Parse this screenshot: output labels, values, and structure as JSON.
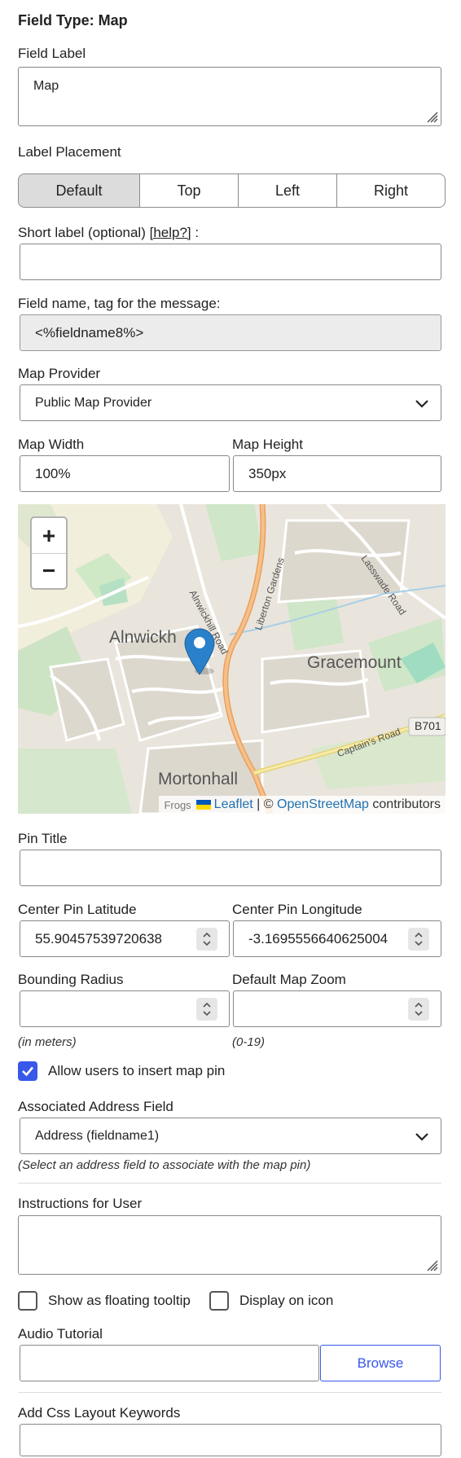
{
  "header": {
    "title": "Field Type: Map"
  },
  "field_label": {
    "label": "Field Label",
    "value": "Map"
  },
  "label_placement": {
    "label": "Label Placement",
    "options": [
      "Default",
      "Top",
      "Left",
      "Right"
    ],
    "selected": "Default"
  },
  "short_label": {
    "label_prefix": "Short label (optional) ",
    "help_link": "[help?]",
    "label_suffix": " :",
    "value": ""
  },
  "field_name": {
    "label": "Field name, tag for the message:",
    "value": "<%fieldname8%>"
  },
  "map_provider": {
    "label": "Map Provider",
    "value": "Public Map Provider"
  },
  "map_width": {
    "label": "Map Width",
    "value": "100%"
  },
  "map_height": {
    "label": "Map Height",
    "value": "350px"
  },
  "map": {
    "zoom_in": "+",
    "zoom_out": "−",
    "place_labels": [
      "Alnwickh",
      "Gracemount",
      "Mortonhall",
      "B701"
    ],
    "road_labels": [
      "Alnwickhill Road",
      "Liberton Gardens",
      "Lasswade Road",
      "Captain's Road"
    ],
    "attribution": {
      "frogs": "Frogs",
      "leaflet": "Leaflet",
      "sep": " | © ",
      "osm": "OpenStreetMap",
      "contributors": " contributors"
    },
    "pin_color": "#2a81cb"
  },
  "pin_title": {
    "label": "Pin Title",
    "value": ""
  },
  "center_lat": {
    "label": "Center Pin Latitude",
    "value": "55.90457539720638"
  },
  "center_lng": {
    "label": "Center Pin Longitude",
    "value": "-3.1695556640625004"
  },
  "bounding_radius": {
    "label": "Bounding Radius",
    "value": "",
    "hint": "(in meters)"
  },
  "default_zoom": {
    "label": "Default Map Zoom",
    "value": "",
    "hint": "(0-19)"
  },
  "allow_insert_pin": {
    "label": "Allow users to insert map pin",
    "checked": true
  },
  "associated_address": {
    "label": "Associated Address Field",
    "value": "Address (fieldname1)",
    "hint": "(Select an address field to associate with the map pin)"
  },
  "instructions": {
    "label": "Instructions for User",
    "value": ""
  },
  "floating_tooltip": {
    "label": "Show as floating tooltip",
    "checked": false
  },
  "display_on_icon": {
    "label": "Display on icon",
    "checked": false
  },
  "audio_tutorial": {
    "label": "Audio Tutorial",
    "value": "",
    "browse": "Browse"
  },
  "css_keywords": {
    "label": "Add Css Layout Keywords",
    "value": ""
  },
  "colors": {
    "accent": "#3858e9",
    "link": "#2271b1"
  }
}
